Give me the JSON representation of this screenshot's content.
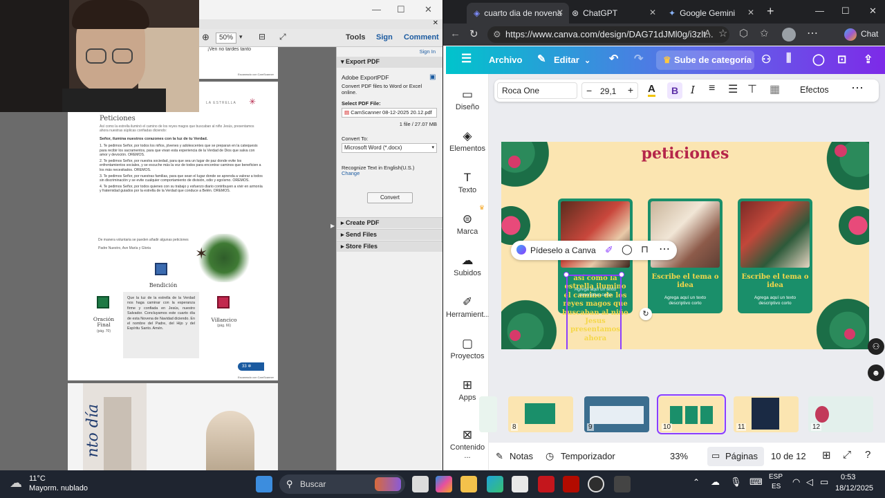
{
  "pdf": {
    "zoom": "50%",
    "toolbar": {
      "tools": "Tools",
      "sign": "Sign",
      "comment": "Comment",
      "sign_in": "Sign In"
    },
    "sidepane": {
      "export_header": "Export PDF",
      "product": "Adobe ExportPDF",
      "desc": "Convert PDF files to Word or Excel online.",
      "select_label": "Select PDF File:",
      "file_name": "CamScanner 08-12-2025 20.12.pdf",
      "file_info": "1 file / 27.07 MB",
      "convert_to_label": "Convert To:",
      "convert_to_value": "Microsoft Word (*.docx)",
      "recognize": "Recognize Text in English(U.S.)",
      "change": "Change",
      "convert_btn": "Convert",
      "create_pdf": "Create PDF",
      "send_files": "Send Files",
      "store_files": "Store Files"
    },
    "page_top_text": "¡Ven no tardes tanto",
    "scanned_by": "Escaneado con CamScanner",
    "page": {
      "estrella": "LA ESTRELLA",
      "title": "Peticiones",
      "intro": "Así como la estrella iluminó el camino de los reyes magos que buscaban al niño Jesús, presentamos ahora nuestras súplicas confiadas diciendo:",
      "response": "Señor, ilumina nuestros corazones con la luz de tu Verdad.",
      "petitions": [
        "1. Te pedimos Señor, por todos los niños, jóvenes y adolescentes que se preparan en la catequesis para recibir los sacramentos, para que vivan esta experiencia de la Verdad de Dios que salva con amor y devoción. OREMOS.",
        "2. Te pedimos Señor, por nuestra sociedad, para que sea un lugar de paz donde evite los enfrentamientos sociales, y se escuche más la voz de todos para encontrar caminos que beneficien a los más necesitados. OREMOS.",
        "3. Te pedimos Señor, por nuestras familias, para que sean el lugar donde se aprenda a valorar a todos sin discriminación y se evite cualquier comportamiento de división, odio y egoísmo. OREMOS.",
        "4. Te pedimos Señor, por todos quienes con su trabajo y esfuerzo diario contribuyen a vivir en armonía y fraternidad guiados por la estrella de la Verdad que conduce a Belén. OREMOS."
      ],
      "optional": "De manera voluntaria se pueden añadir algunas peticiones",
      "prayers": "Padre Nuestro, Ave María y Gloria",
      "bendicion": "Bendición",
      "oracion_final": "Oración Final",
      "oracion_pag": "(pág. 70)",
      "villancico": "Villancico",
      "villancico_pag": "(pág. 66)",
      "blessing_text": "Que la luz de la estrella de la Verdad nos haga caminar con la esperanza firme y confiada en Jesús, nuestro Salvador. Concluyamos este cuarto día de esta Novena de Navidad diciendo. En el nombre del Padre, del Hijo y del Espíritu Santo. Amén.",
      "page_num": "33"
    },
    "next_page_text": "nto día"
  },
  "browser": {
    "tabs": [
      {
        "label": "cuarto dia de novena",
        "active": true
      },
      {
        "label": "ChatGPT",
        "active": false
      },
      {
        "label": "Google Gemini",
        "active": false
      }
    ],
    "url": "https://www.canva.com/design/DAG71dJMl0g/i3zlt...",
    "chat_label": "Chat"
  },
  "canva": {
    "top": {
      "archivo": "Archivo",
      "editar": "Editar",
      "upgrade": "Sube de categoría"
    },
    "side": [
      "Diseño",
      "Elementos",
      "Texto",
      "Marca",
      "Subidos",
      "Herramient...",
      "Proyectos",
      "Apps",
      "Contenido ..."
    ],
    "ctx": {
      "font": "Roca One",
      "size": "29,1",
      "effects": "Efectos"
    },
    "slide_title": "peticiones",
    "ask_canva": "Pídeselo a Canva",
    "cards": [
      {
        "title": "así como la estrella ilumino el camino de los reyes magos que buscaban al niño Jesus presentamos ahora",
        "sub": "Agrega aquí un texto descriptivo corto"
      },
      {
        "title": "Escribe el tema o idea",
        "sub": "Agrega aquí un texto descriptivo corto"
      },
      {
        "title": "Escribe el tema o idea",
        "sub": "Agrega aquí un texto descriptivo corto"
      }
    ],
    "thumbs": [
      "8",
      "9",
      "10",
      "11",
      "12"
    ],
    "bottom": {
      "notas": "Notas",
      "timer": "Temporizador",
      "zoom": "33%",
      "pages": "Páginas",
      "page_count": "10 de 12"
    },
    "colors": {
      "brand_teal": "#00c4cc",
      "brand_purple": "#7d2ae8",
      "slide_bg": "#fbe5b1",
      "card_green": "#1a8f6a",
      "title_red": "#b5264a"
    }
  },
  "taskbar": {
    "temp": "11°C",
    "weather": "Mayorm. nublado",
    "search": "Buscar",
    "lang1": "ESP",
    "lang2": "ES",
    "time": "0:53",
    "date": "18/12/2025"
  }
}
